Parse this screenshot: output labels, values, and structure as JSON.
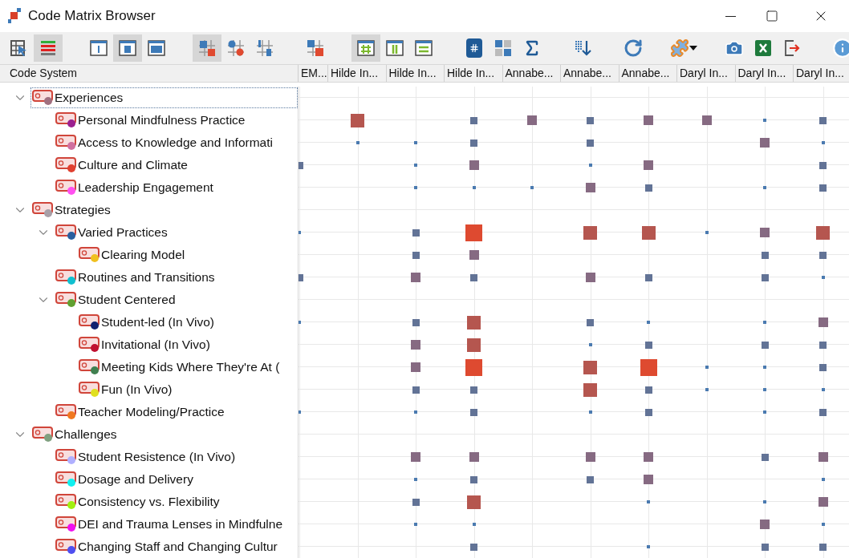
{
  "window": {
    "title": "Code Matrix Browser"
  },
  "toolbar": [
    [
      {
        "kind": "select",
        "selected": false
      },
      {
        "kind": "bars",
        "selected": true
      }
    ],
    [
      {
        "kind": "frame-thin",
        "selected": false
      },
      {
        "kind": "frame-mid",
        "selected": true
      },
      {
        "kind": "frame-full",
        "selected": false
      }
    ],
    [
      {
        "kind": "squares",
        "selected": true
      },
      {
        "kind": "circles",
        "selected": false
      },
      {
        "kind": "links",
        "selected": false
      }
    ],
    [
      {
        "kind": "grid-badge",
        "selected": false
      }
    ],
    [
      {
        "kind": "hash",
        "selected": true
      },
      {
        "kind": "columns",
        "selected": false
      },
      {
        "kind": "rows",
        "selected": false
      }
    ],
    [
      {
        "kind": "doc",
        "selected": false
      },
      {
        "kind": "tiles",
        "selected": false
      },
      {
        "kind": "sigma",
        "selected": false
      }
    ],
    [
      {
        "kind": "sort",
        "selected": false
      }
    ],
    [
      {
        "kind": "refresh",
        "selected": false
      }
    ],
    [
      {
        "kind": "puzzle",
        "selected": false
      }
    ],
    [
      {
        "kind": "camera",
        "selected": false
      },
      {
        "kind": "excel",
        "selected": false
      },
      {
        "kind": "export",
        "selected": false
      }
    ],
    [
      {
        "kind": "info",
        "selected": false
      }
    ]
  ],
  "tree_header": "Code System",
  "columns": [
    "EM...",
    "Hilde In...",
    "Hilde In...",
    "Hilde In...",
    "Annabe...",
    "Annabe...",
    "Annabe...",
    "Daryl In...",
    "Daryl In...",
    "Daryl In..."
  ],
  "tree": [
    {
      "label": "Experiences",
      "color": "#a07080",
      "expanded": true,
      "selected": true,
      "children": [
        {
          "label": "Personal Mindfulness Practice",
          "color": "#9b2090",
          "selected": false,
          "cells": [
            {
              "kind": "empty"
            },
            {
              "kind": "large"
            },
            {
              "kind": "empty"
            },
            {
              "kind": "small"
            },
            {
              "kind": "medium"
            },
            {
              "kind": "small"
            },
            {
              "kind": "medium"
            },
            {
              "kind": "medium"
            },
            {
              "kind": "tiny"
            },
            {
              "kind": "small"
            }
          ]
        },
        {
          "label": "Access to Knowledge and Informati",
          "color": "#d070a0",
          "selected": false,
          "cells": [
            {
              "kind": "empty"
            },
            {
              "kind": "tiny"
            },
            {
              "kind": "tiny"
            },
            {
              "kind": "small"
            },
            {
              "kind": "empty"
            },
            {
              "kind": "small"
            },
            {
              "kind": "empty"
            },
            {
              "kind": "empty"
            },
            {
              "kind": "medium"
            },
            {
              "kind": "tiny"
            }
          ]
        },
        {
          "label": "Culture and Climate",
          "color": "#e04030",
          "selected": false,
          "cells": [
            {
              "kind": "small"
            },
            {
              "kind": "empty"
            },
            {
              "kind": "tiny"
            },
            {
              "kind": "medium"
            },
            {
              "kind": "empty"
            },
            {
              "kind": "tiny"
            },
            {
              "kind": "medium"
            },
            {
              "kind": "empty"
            },
            {
              "kind": "empty"
            },
            {
              "kind": "small"
            }
          ]
        },
        {
          "label": "Leadership Engagement",
          "color": "#ff50f0",
          "selected": false,
          "cells": [
            {
              "kind": "empty"
            },
            {
              "kind": "empty"
            },
            {
              "kind": "tiny"
            },
            {
              "kind": "tiny"
            },
            {
              "kind": "tiny"
            },
            {
              "kind": "medium"
            },
            {
              "kind": "small"
            },
            {
              "kind": "empty"
            },
            {
              "kind": "tiny"
            },
            {
              "kind": "small"
            }
          ]
        }
      ]
    },
    {
      "label": "Strategies",
      "color": "#a8a0a8",
      "expanded": true,
      "selected": false,
      "children": [
        {
          "label": "Varied Practices",
          "color": "#2a60a0",
          "expanded": true,
          "selected": false,
          "cells": [
            {
              "kind": "tiny"
            },
            {
              "kind": "empty"
            },
            {
              "kind": "small"
            },
            {
              "kind": "huge"
            },
            {
              "kind": "empty"
            },
            {
              "kind": "large"
            },
            {
              "kind": "large"
            },
            {
              "kind": "tiny"
            },
            {
              "kind": "medium"
            },
            {
              "kind": "large"
            }
          ],
          "children": [
            {
              "label": "Clearing Model",
              "color": "#f0c020",
              "selected": false,
              "cells": [
                {
                  "kind": "empty"
                },
                {
                  "kind": "empty"
                },
                {
                  "kind": "small"
                },
                {
                  "kind": "medium"
                },
                {
                  "kind": "empty"
                },
                {
                  "kind": "empty"
                },
                {
                  "kind": "empty"
                },
                {
                  "kind": "empty"
                },
                {
                  "kind": "small"
                },
                {
                  "kind": "small"
                }
              ]
            }
          ]
        },
        {
          "label": "Routines and Transitions",
          "color": "#10c0d0",
          "selected": false,
          "cells": [
            {
              "kind": "small"
            },
            {
              "kind": "empty"
            },
            {
              "kind": "medium"
            },
            {
              "kind": "small"
            },
            {
              "kind": "empty"
            },
            {
              "kind": "medium"
            },
            {
              "kind": "small"
            },
            {
              "kind": "empty"
            },
            {
              "kind": "small"
            },
            {
              "kind": "tiny"
            }
          ]
        },
        {
          "label": "Student Centered",
          "color": "#60a030",
          "expanded": true,
          "selected": false,
          "children": [
            {
              "label": "Student-led (In Vivo)",
              "color": "#102070",
              "selected": false,
              "cells": [
                {
                  "kind": "tiny"
                },
                {
                  "kind": "empty"
                },
                {
                  "kind": "small"
                },
                {
                  "kind": "large"
                },
                {
                  "kind": "empty"
                },
                {
                  "kind": "small"
                },
                {
                  "kind": "tiny"
                },
                {
                  "kind": "empty"
                },
                {
                  "kind": "tiny"
                },
                {
                  "kind": "medium"
                }
              ]
            },
            {
              "label": "Invitational (In Vivo)",
              "color": "#c01030",
              "selected": false,
              "cells": [
                {
                  "kind": "empty"
                },
                {
                  "kind": "empty"
                },
                {
                  "kind": "medium"
                },
                {
                  "kind": "large"
                },
                {
                  "kind": "empty"
                },
                {
                  "kind": "tiny"
                },
                {
                  "kind": "small"
                },
                {
                  "kind": "empty"
                },
                {
                  "kind": "small"
                },
                {
                  "kind": "small"
                }
              ]
            },
            {
              "label": "Meeting Kids Where They're At (",
              "color": "#408050",
              "selected": false,
              "cells": [
                {
                  "kind": "empty"
                },
                {
                  "kind": "empty"
                },
                {
                  "kind": "medium"
                },
                {
                  "kind": "huge"
                },
                {
                  "kind": "empty"
                },
                {
                  "kind": "large"
                },
                {
                  "kind": "huge"
                },
                {
                  "kind": "tiny"
                },
                {
                  "kind": "tiny"
                },
                {
                  "kind": "small"
                }
              ]
            },
            {
              "label": "Fun (In Vivo)",
              "color": "#e0e020",
              "selected": false,
              "cells": [
                {
                  "kind": "empty"
                },
                {
                  "kind": "empty"
                },
                {
                  "kind": "small"
                },
                {
                  "kind": "small"
                },
                {
                  "kind": "empty"
                },
                {
                  "kind": "large"
                },
                {
                  "kind": "small"
                },
                {
                  "kind": "tiny"
                },
                {
                  "kind": "tiny"
                },
                {
                  "kind": "tiny"
                }
              ]
            }
          ]
        },
        {
          "label": "Teacher Modeling/Practice",
          "color": "#f07820",
          "selected": false,
          "cells": [
            {
              "kind": "tiny"
            },
            {
              "kind": "empty"
            },
            {
              "kind": "tiny"
            },
            {
              "kind": "small"
            },
            {
              "kind": "empty"
            },
            {
              "kind": "tiny"
            },
            {
              "kind": "small"
            },
            {
              "kind": "empty"
            },
            {
              "kind": "tiny"
            },
            {
              "kind": "small"
            }
          ]
        }
      ]
    },
    {
      "label": "Challenges",
      "color": "#80a080",
      "expanded": true,
      "selected": false,
      "children": [
        {
          "label": "Student Resistence (In Vivo)",
          "color": "#b0b0ff",
          "selected": false,
          "cells": [
            {
              "kind": "empty"
            },
            {
              "kind": "empty"
            },
            {
              "kind": "medium"
            },
            {
              "kind": "medium"
            },
            {
              "kind": "empty"
            },
            {
              "kind": "medium"
            },
            {
              "kind": "medium"
            },
            {
              "kind": "empty"
            },
            {
              "kind": "small"
            },
            {
              "kind": "medium"
            }
          ]
        },
        {
          "label": "Dosage and Delivery",
          "color": "#10f0f0",
          "selected": false,
          "cells": [
            {
              "kind": "empty"
            },
            {
              "kind": "empty"
            },
            {
              "kind": "tiny"
            },
            {
              "kind": "small"
            },
            {
              "kind": "empty"
            },
            {
              "kind": "small"
            },
            {
              "kind": "medium"
            },
            {
              "kind": "empty"
            },
            {
              "kind": "empty"
            },
            {
              "kind": "tiny"
            }
          ]
        },
        {
          "label": "Consistency vs. Flexibility",
          "color": "#a0f010",
          "selected": false,
          "cells": [
            {
              "kind": "empty"
            },
            {
              "kind": "empty"
            },
            {
              "kind": "small"
            },
            {
              "kind": "large"
            },
            {
              "kind": "empty"
            },
            {
              "kind": "empty"
            },
            {
              "kind": "tiny"
            },
            {
              "kind": "empty"
            },
            {
              "kind": "tiny"
            },
            {
              "kind": "medium"
            }
          ]
        },
        {
          "label": "DEI and Trauma Lenses in Mindfulne",
          "color": "#f010f0",
          "selected": false,
          "cells": [
            {
              "kind": "empty"
            },
            {
              "kind": "empty"
            },
            {
              "kind": "tiny"
            },
            {
              "kind": "tiny"
            },
            {
              "kind": "empty"
            },
            {
              "kind": "empty"
            },
            {
              "kind": "empty"
            },
            {
              "kind": "empty"
            },
            {
              "kind": "medium"
            },
            {
              "kind": "tiny"
            }
          ]
        },
        {
          "label": "Changing Staff and Changing Cultur",
          "color": "#5050f0",
          "selected": false,
          "cells": [
            {
              "kind": "empty"
            },
            {
              "kind": "empty"
            },
            {
              "kind": "empty"
            },
            {
              "kind": "small"
            },
            {
              "kind": "empty"
            },
            {
              "kind": "empty"
            },
            {
              "kind": "tiny"
            },
            {
              "kind": "empty"
            },
            {
              "kind": "small"
            },
            {
              "kind": "small"
            }
          ]
        }
      ]
    }
  ]
}
